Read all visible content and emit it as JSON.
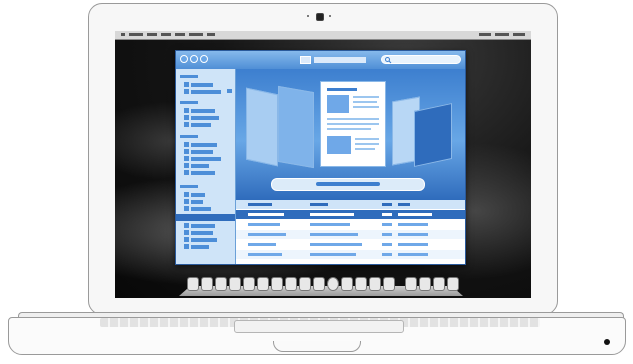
{
  "device": {
    "name": "laptop",
    "camera_icon": "camera-icon",
    "sleep_light_icon": "sleep-indicator-icon"
  },
  "desktop": {
    "wallpaper": "space-aurora",
    "colors": {
      "window_accent": "#4f8fd6",
      "sidebar_bg": "#cfe4f8",
      "coverflow_bg": "#3d7fcf"
    }
  },
  "app_window": {
    "traffic_lights": [
      "close-icon",
      "minimize-icon",
      "zoom-icon"
    ],
    "search_icon": "search-icon",
    "view": "cover-flow",
    "sidebar_sections": 4,
    "list_rows": 6
  },
  "dock": {
    "icon_count": 20
  }
}
